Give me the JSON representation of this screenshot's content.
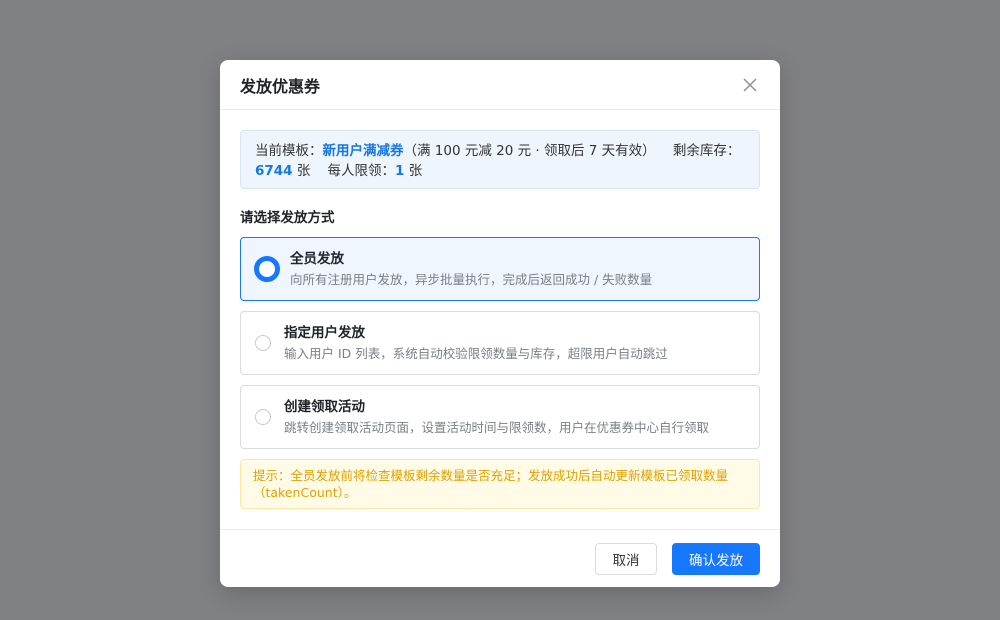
{
  "modal": {
    "title": "发放优惠券",
    "close_icon": "close-icon"
  },
  "info": {
    "template_label": "当前模板：",
    "template_name": "新用户满减券",
    "template_detail": "（满 100 元减 20 元 · 领取后 7 天有效）",
    "stock_label": "剩余库存：",
    "stock_value": "6744",
    "stock_unit": " 张",
    "limit_label": "每人限领：",
    "limit_value": "1",
    "limit_unit": " 张"
  },
  "section_title": "请选择发放方式",
  "options": [
    {
      "title": "全员发放",
      "desc": "向所有注册用户发放，异步批量执行，完成后返回成功 / 失败数量",
      "selected": true
    },
    {
      "title": "指定用户发放",
      "desc": "输入用户 ID 列表，系统自动校验限领数量与库存，超限用户自动跳过",
      "selected": false
    },
    {
      "title": "创建领取活动",
      "desc": "跳转创建领取活动页面，设置活动时间与限领数，用户在优惠券中心自行领取",
      "selected": false
    }
  ],
  "tip": "提示：全员发放前将检查模板剩余数量是否充足；发放成功后自动更新模板已领取数量（takenCount）。",
  "footer": {
    "cancel_label": "取消",
    "confirm_label": "确认发放"
  },
  "colors": {
    "primary": "#1677ff",
    "overlay": "#808185",
    "tip_text": "#e0a100"
  }
}
